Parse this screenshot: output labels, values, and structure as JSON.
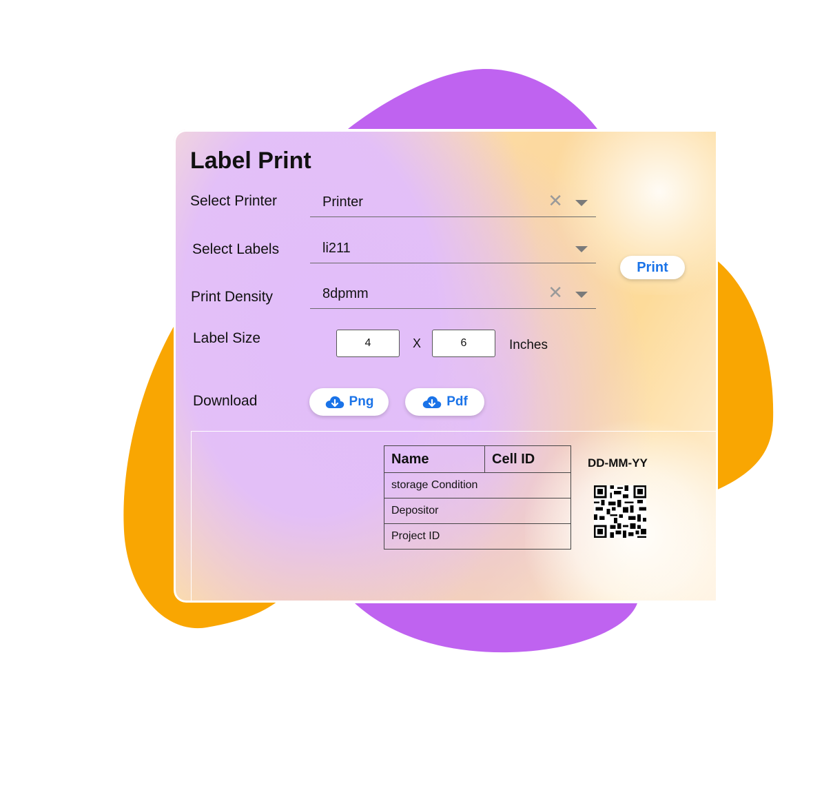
{
  "title": "Label Print",
  "form": {
    "printer": {
      "label": "Select Printer",
      "value": "Printer"
    },
    "labels": {
      "label": "Select Labels",
      "value": "li211"
    },
    "density": {
      "label": "Print Density",
      "value": "8dpmm"
    },
    "size": {
      "label": "Label Size",
      "width": "4",
      "separator": "X",
      "height": "6",
      "unit": "Inches"
    },
    "download": {
      "label": "Download",
      "png": "Png",
      "pdf": "Pdf"
    },
    "print_button": "Print"
  },
  "preview": {
    "header": {
      "name": "Name",
      "cell_id": "Cell ID"
    },
    "rows": [
      "storage Condition",
      "Depositor",
      "Project ID"
    ],
    "date": "DD-MM-YY"
  },
  "colors": {
    "purple": "#bf63f0",
    "orange": "#f9a602",
    "accent": "#1a73e8"
  },
  "icons": [
    "close-icon",
    "chevron-down-icon",
    "cloud-download-icon",
    "qr-code-icon"
  ]
}
